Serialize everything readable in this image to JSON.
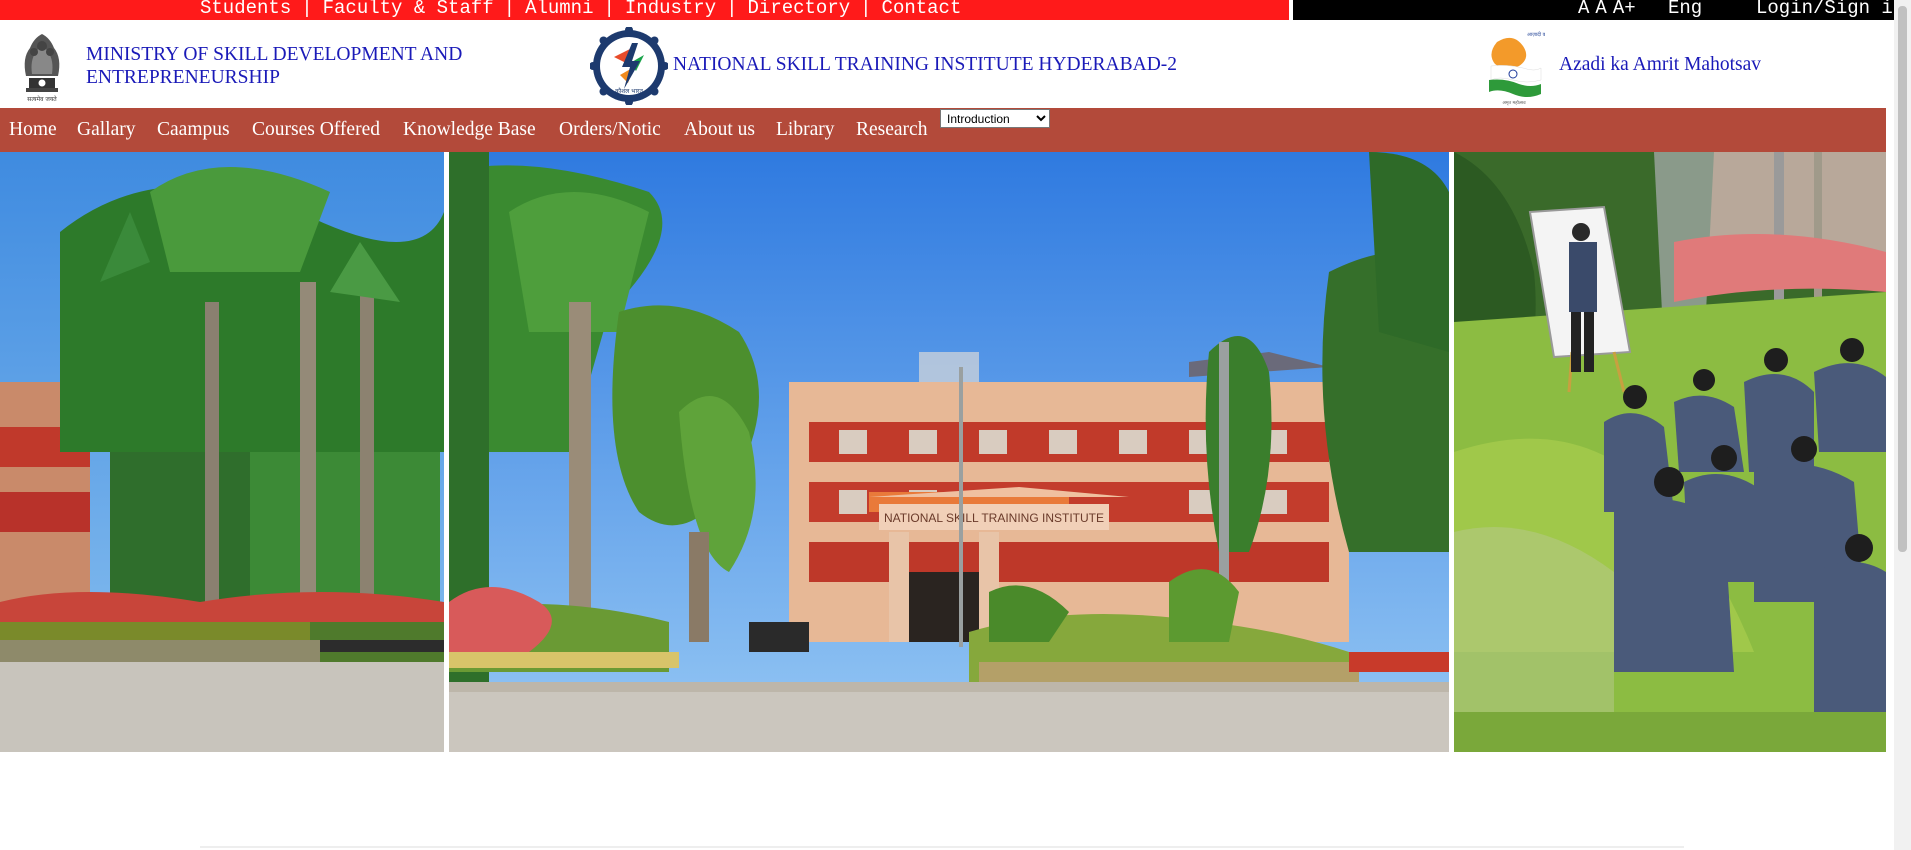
{
  "topbar": {
    "links": [
      "Students",
      "Faculty & Staff",
      "Alumni",
      "Industry",
      "Directory",
      "Contact"
    ],
    "font_sizes": [
      "A",
      "A",
      "A+"
    ],
    "language": "Eng",
    "login": "Login/Sign in"
  },
  "header": {
    "ministry_line1": "MINISTRY OF SKILL DEVELOPMENT AND",
    "ministry_line2": "ENTREPRENEURSHIP",
    "institute_name": "NATIONAL SKILL TRAINING INSTITUTE HYDERABAD-2",
    "azadi_text": "Azadi ka Amrit Mahotsav",
    "emblem_caption": "सत्यमेव जयते"
  },
  "nav": {
    "items": [
      "Home",
      "Gallary",
      "Caampus",
      "Courses Offered",
      "Knowledge Base",
      "Orders/Notic",
      "About us",
      "Library",
      "Research"
    ],
    "select_value": "Introduction"
  },
  "hero": {
    "building_sign": "NATIONAL SKILL TRAINING INSTITUTE"
  },
  "colors": {
    "topbar_red": "#ff1a1a",
    "topbar_black": "#000000",
    "nav_bg": "#b34a3a",
    "header_text": "#1a1ab8"
  }
}
